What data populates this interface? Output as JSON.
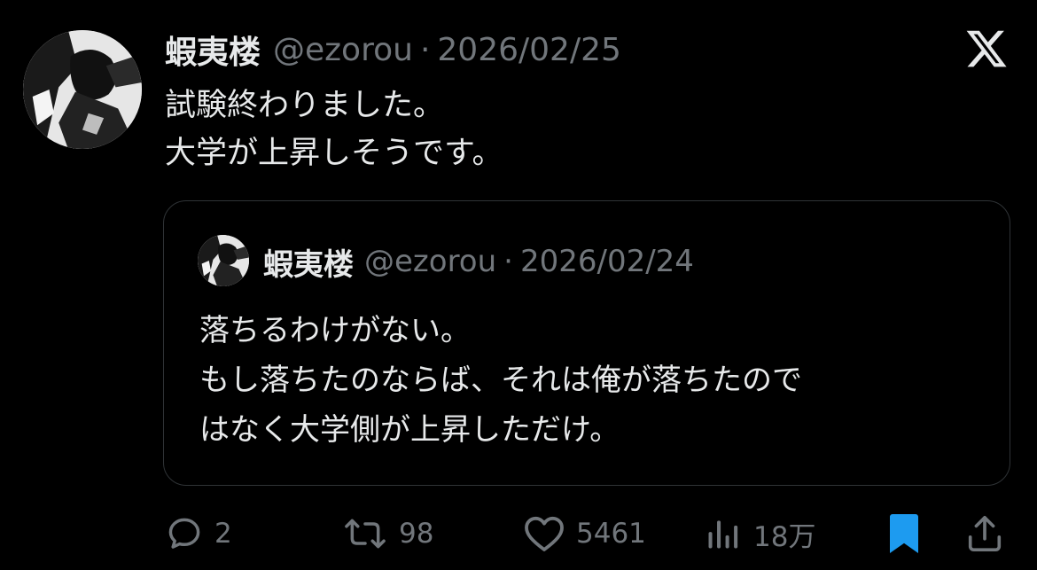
{
  "tweet": {
    "author": {
      "name": "蝦夷楼",
      "handle": "@ezorou",
      "separator": "·",
      "date": "2026/02/25"
    },
    "text_lines": [
      "試験終わりました。",
      "大学が上昇しそうです。"
    ],
    "brand_icon": "x-logo-icon"
  },
  "quote": {
    "author": {
      "name": "蝦夷楼",
      "handle": "@ezorou",
      "separator": "·",
      "date": "2026/02/24"
    },
    "text_lines": [
      "落ちるわけがない。",
      "もし落ちたのならば、それは俺が落ちたので",
      "はなく大学側が上昇しただけ。"
    ]
  },
  "actions": {
    "reply": {
      "icon": "reply-icon",
      "count": "2"
    },
    "retweet": {
      "icon": "retweet-icon",
      "count": "98"
    },
    "like": {
      "icon": "heart-icon",
      "count": "5461"
    },
    "views": {
      "icon": "views-icon",
      "count": "18万"
    },
    "bookmark": {
      "icon": "bookmark-icon",
      "active": true
    },
    "share": {
      "icon": "share-icon"
    }
  },
  "colors": {
    "background": "#000000",
    "text": "#e7e9ea",
    "secondary_text": "#71767b",
    "border": "#2f3336",
    "bookmark_active": "#1d9bf0"
  }
}
